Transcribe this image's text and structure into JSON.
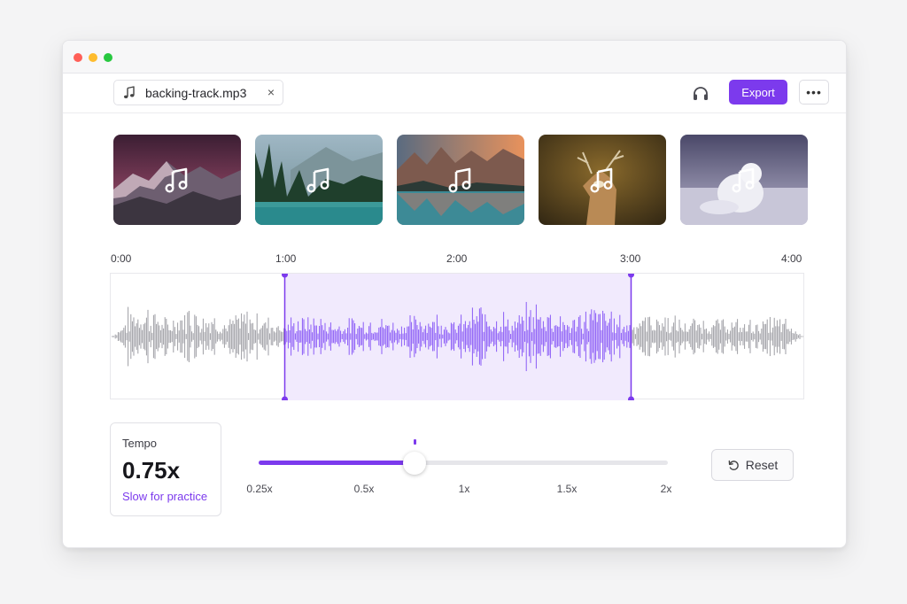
{
  "file": {
    "name": "backing-track.mp3",
    "close_glyph": "×"
  },
  "toolbar": {
    "export_label": "Export",
    "more_glyph": "•••"
  },
  "icons": {
    "file": "music-note-icon",
    "monitor": "headphones-icon",
    "overlay": "music-note-icon",
    "reset": "rotate-ccw-icon"
  },
  "thumbnails": [
    {
      "scene": "dusk-mountains"
    },
    {
      "scene": "forest-lake"
    },
    {
      "scene": "alpine-lake-sunset"
    },
    {
      "scene": "deer"
    },
    {
      "scene": "arctic-fox"
    }
  ],
  "timeline": {
    "ticks": [
      "0:00",
      "1:00",
      "2:00",
      "3:00",
      "4:00"
    ],
    "duration_seconds": 240,
    "selection_seconds": [
      60,
      180
    ]
  },
  "tempo": {
    "label": "Tempo",
    "value": "0.75x",
    "hint": "Slow for practice",
    "numeric": 0.75,
    "min": 0.25,
    "max": 2,
    "ticks": [
      "0.25x",
      "0.5x",
      "1x",
      "1.5x",
      "2x"
    ],
    "tick_values": [
      0.25,
      0.5,
      1,
      1.5,
      2
    ]
  },
  "reset": {
    "label": "Reset"
  },
  "colors": {
    "accent": "#7c3aed",
    "selection_fill": "#f1eafd",
    "wave_inactive": "#9e9ea4",
    "wave_active": "#8b5cf6"
  }
}
